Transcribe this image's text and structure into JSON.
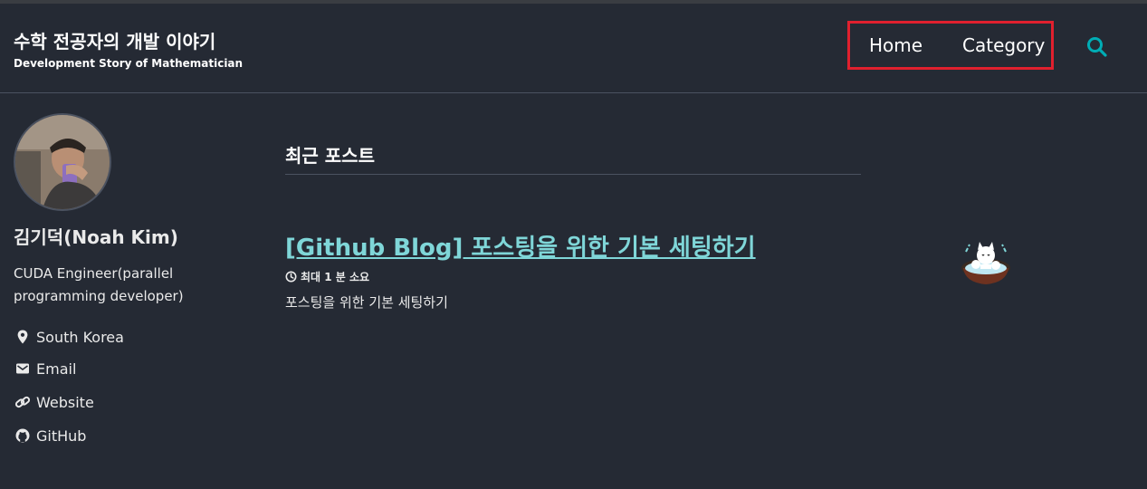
{
  "header": {
    "title": "수학 전공자의 개발 이야기",
    "subtitle": "Development Story of Mathematician",
    "nav": [
      {
        "label": "Home"
      },
      {
        "label": "Category"
      }
    ],
    "search_icon": "search-icon",
    "accent_color": "#00adb5"
  },
  "sidebar": {
    "name": "김기덕(Noah Kim)",
    "bio": "CUDA Engineer(parallel programming developer)",
    "links": [
      {
        "icon": "map-marker-icon",
        "label": "South Korea"
      },
      {
        "icon": "envelope-icon",
        "label": "Email"
      },
      {
        "icon": "link-icon",
        "label": "Website"
      },
      {
        "icon": "github-icon",
        "label": "GitHub"
      }
    ]
  },
  "main": {
    "section_title": "최근 포스트",
    "posts": [
      {
        "title": "[Github Blog] 포스팅을 위한 기본 세팅하기",
        "read_time": "최대 1 분 소요",
        "excerpt": "포스팅을 위한 기본 세팅하기"
      }
    ]
  },
  "colors": {
    "background": "#252a34",
    "link": "#7fd6d8",
    "highlight_box": "#e0202e"
  }
}
